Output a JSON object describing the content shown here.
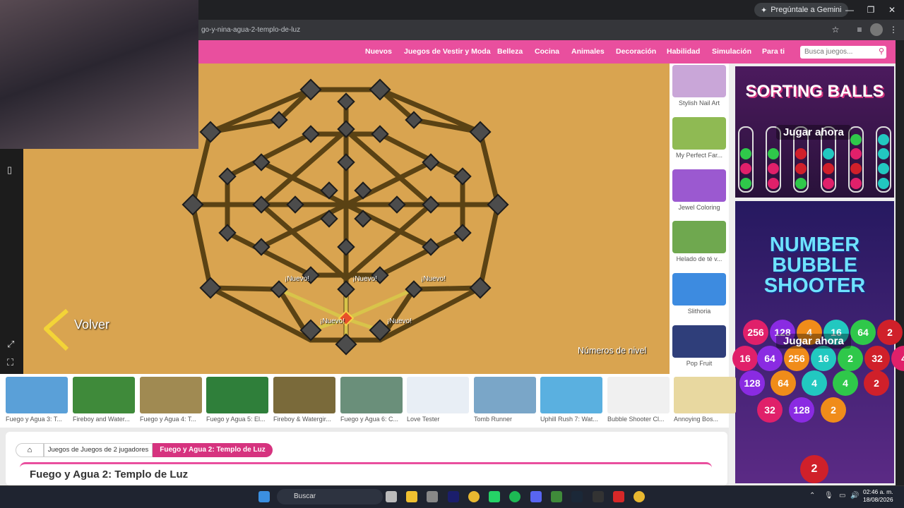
{
  "browser": {
    "gemini_label": "Pregúntale a Gemini",
    "url": "go-y-nina-agua-2-templo-de-luz",
    "win_min": "—",
    "win_max": "❐",
    "win_close": "✕"
  },
  "site": {
    "nav": [
      "Nuevos",
      "Juegos de Vestir y Moda",
      "Belleza",
      "Cocina",
      "Animales",
      "Decoración",
      "Habilidad",
      "Simulación",
      "Para ti"
    ],
    "search_placeholder": "Busca juegos..."
  },
  "game": {
    "nuevo": "¡Nuevo!",
    "back_label": "Volver",
    "level_numbers_label": "Números de nivel"
  },
  "side_thumbs": [
    {
      "label": "Stylish Nail Art",
      "color": "#c9a6d8"
    },
    {
      "label": "My Perfect Far...",
      "color": "#8fba53"
    },
    {
      "label": "Jewel Coloring",
      "color": "#9b59d0"
    },
    {
      "label": "Helado de té v...",
      "color": "#6fa84f"
    },
    {
      "label": "Slithoria",
      "color": "#3d8be0"
    },
    {
      "label": "Pop Fruit",
      "color": "#2f3e7a"
    }
  ],
  "ads": {
    "ad1_title": "SORTING BALLS",
    "ad2_title_1": "NUMBER",
    "ad2_title_2": "BUBBLE",
    "ad2_title_3": "SHOOTER",
    "play_label": "Jugar ahora",
    "bubbles": [
      "256",
      "128",
      "4",
      "16",
      "64",
      "2",
      "16",
      "64",
      "256",
      "16",
      "2",
      "32",
      "4",
      "128",
      "64",
      "4",
      "4",
      "2",
      "32",
      "128",
      "2"
    ]
  },
  "bottom_games": [
    {
      "label": "Fuego y Agua 3: T...",
      "color": "#5aa0d8"
    },
    {
      "label": "Fireboy and Water...",
      "color": "#3f8a3a"
    },
    {
      "label": "Fuego y Agua 4: T...",
      "color": "#a08a52"
    },
    {
      "label": "Fuego y Agua 5: El...",
      "color": "#2f7f3a"
    },
    {
      "label": "Fireboy & Watergir...",
      "color": "#7a6a3a"
    },
    {
      "label": "Fuego y Agua 6: C...",
      "color": "#6a8f7a"
    },
    {
      "label": "Love Tester",
      "color": "#e8eef5"
    },
    {
      "label": "Tomb Runner",
      "color": "#7aa6c8"
    },
    {
      "label": "Uphill Rush 7: Wat...",
      "color": "#5ab0e0"
    },
    {
      "label": "Bubble Shooter Cl...",
      "color": "#f0f0f0"
    },
    {
      "label": "Annoying Bos...",
      "color": "#e8d8a0"
    }
  ],
  "breadcrumb": {
    "home_icon": "⌂",
    "cat": "Juegos de Juegos de 2 jugadores",
    "current": "Fuego y Agua 2: Templo de Luz"
  },
  "page_title": "Fuego y Agua 2: Templo de Luz",
  "taskbar": {
    "search": "Buscar",
    "time": "02:46 a. m.",
    "date": "18/08/2026"
  }
}
